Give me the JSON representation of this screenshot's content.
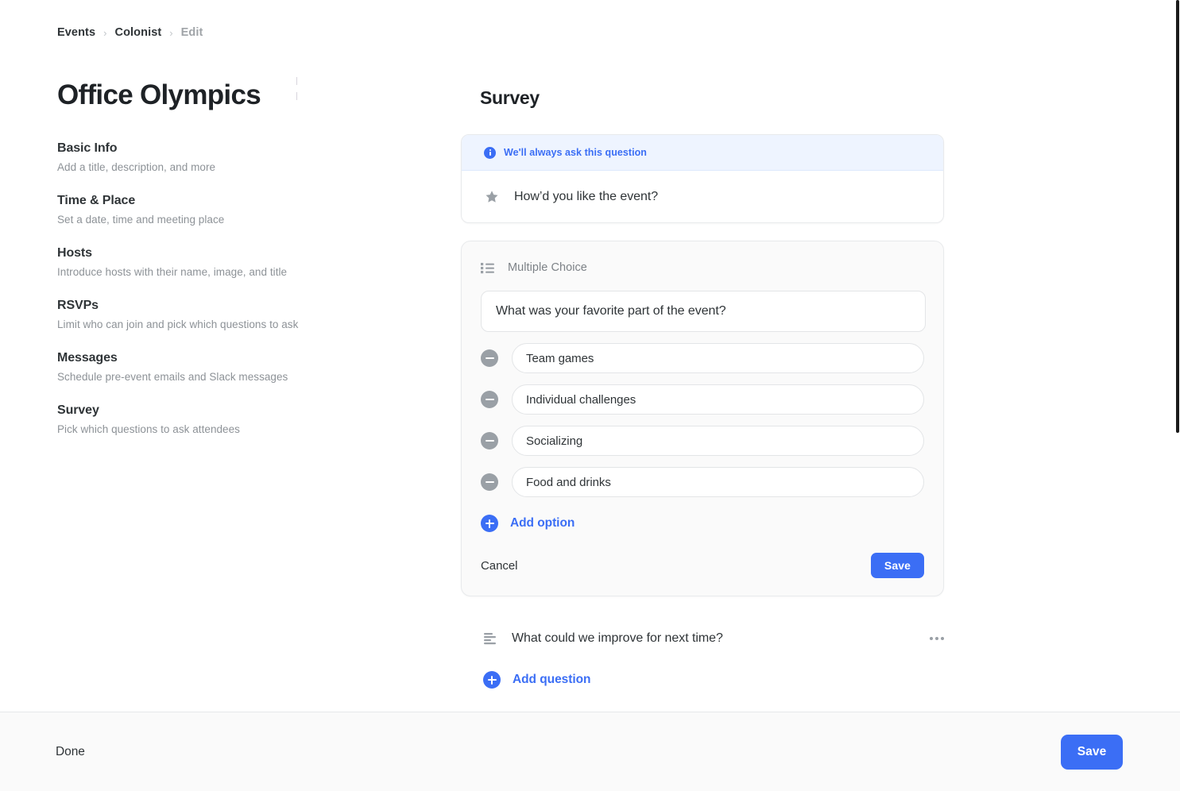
{
  "breadcrumb": {
    "items": [
      {
        "label": "Events",
        "muted": false
      },
      {
        "label": "Colonist",
        "muted": false
      },
      {
        "label": "Edit",
        "muted": true
      }
    ],
    "separator": "›"
  },
  "event": {
    "title": "Office Olympics"
  },
  "sidebar": {
    "items": [
      {
        "title": "Basic Info",
        "desc": "Add a title, description, and more"
      },
      {
        "title": "Time & Place",
        "desc": "Set a date, time and meeting place"
      },
      {
        "title": "Hosts",
        "desc": "Introduce hosts with their name, image, and title"
      },
      {
        "title": "RSVPs",
        "desc": "Limit who can join and pick which questions to ask"
      },
      {
        "title": "Messages",
        "desc": "Schedule pre-event emails and Slack messages"
      },
      {
        "title": "Survey",
        "desc": "Pick which questions to ask attendees"
      }
    ]
  },
  "survey": {
    "heading": "Survey",
    "always_card": {
      "banner_text": "We'll always ask this question",
      "banner_icon": "info-circle-icon",
      "question_icon": "star-icon",
      "question": "How’d you like the event?"
    },
    "editor_card": {
      "type_icon": "bulleted-list-icon",
      "type_label": "Multiple Choice",
      "question_value": "What was your favorite part of the event?",
      "question_placeholder": "Question",
      "options": [
        {
          "value": "Team games",
          "remove_icon": "minus-circle-icon"
        },
        {
          "value": "Individual challenges",
          "remove_icon": "minus-circle-icon"
        },
        {
          "value": "Socializing",
          "remove_icon": "minus-circle-icon"
        },
        {
          "value": "Food and drinks",
          "remove_icon": "minus-circle-icon"
        }
      ],
      "option_placeholder": "Option",
      "add_option_label": "Add option",
      "add_option_icon": "plus-circle-icon",
      "cancel_label": "Cancel",
      "save_label": "Save"
    },
    "other_question": {
      "icon": "text-lines-icon",
      "text": "What could we improve for next time?",
      "menu_icon": "ellipsis-icon"
    },
    "add_question_label": "Add question",
    "add_question_icon": "plus-circle-icon"
  },
  "footer": {
    "done_label": "Done",
    "save_label": "Save"
  },
  "colors": {
    "accent": "#3b6ef5",
    "banner_bg": "#eef4ff",
    "card_bg": "#fafafa",
    "text_primary": "#2f3437",
    "text_muted": "#8d9297",
    "icon_gray": "#9aa0a6"
  }
}
